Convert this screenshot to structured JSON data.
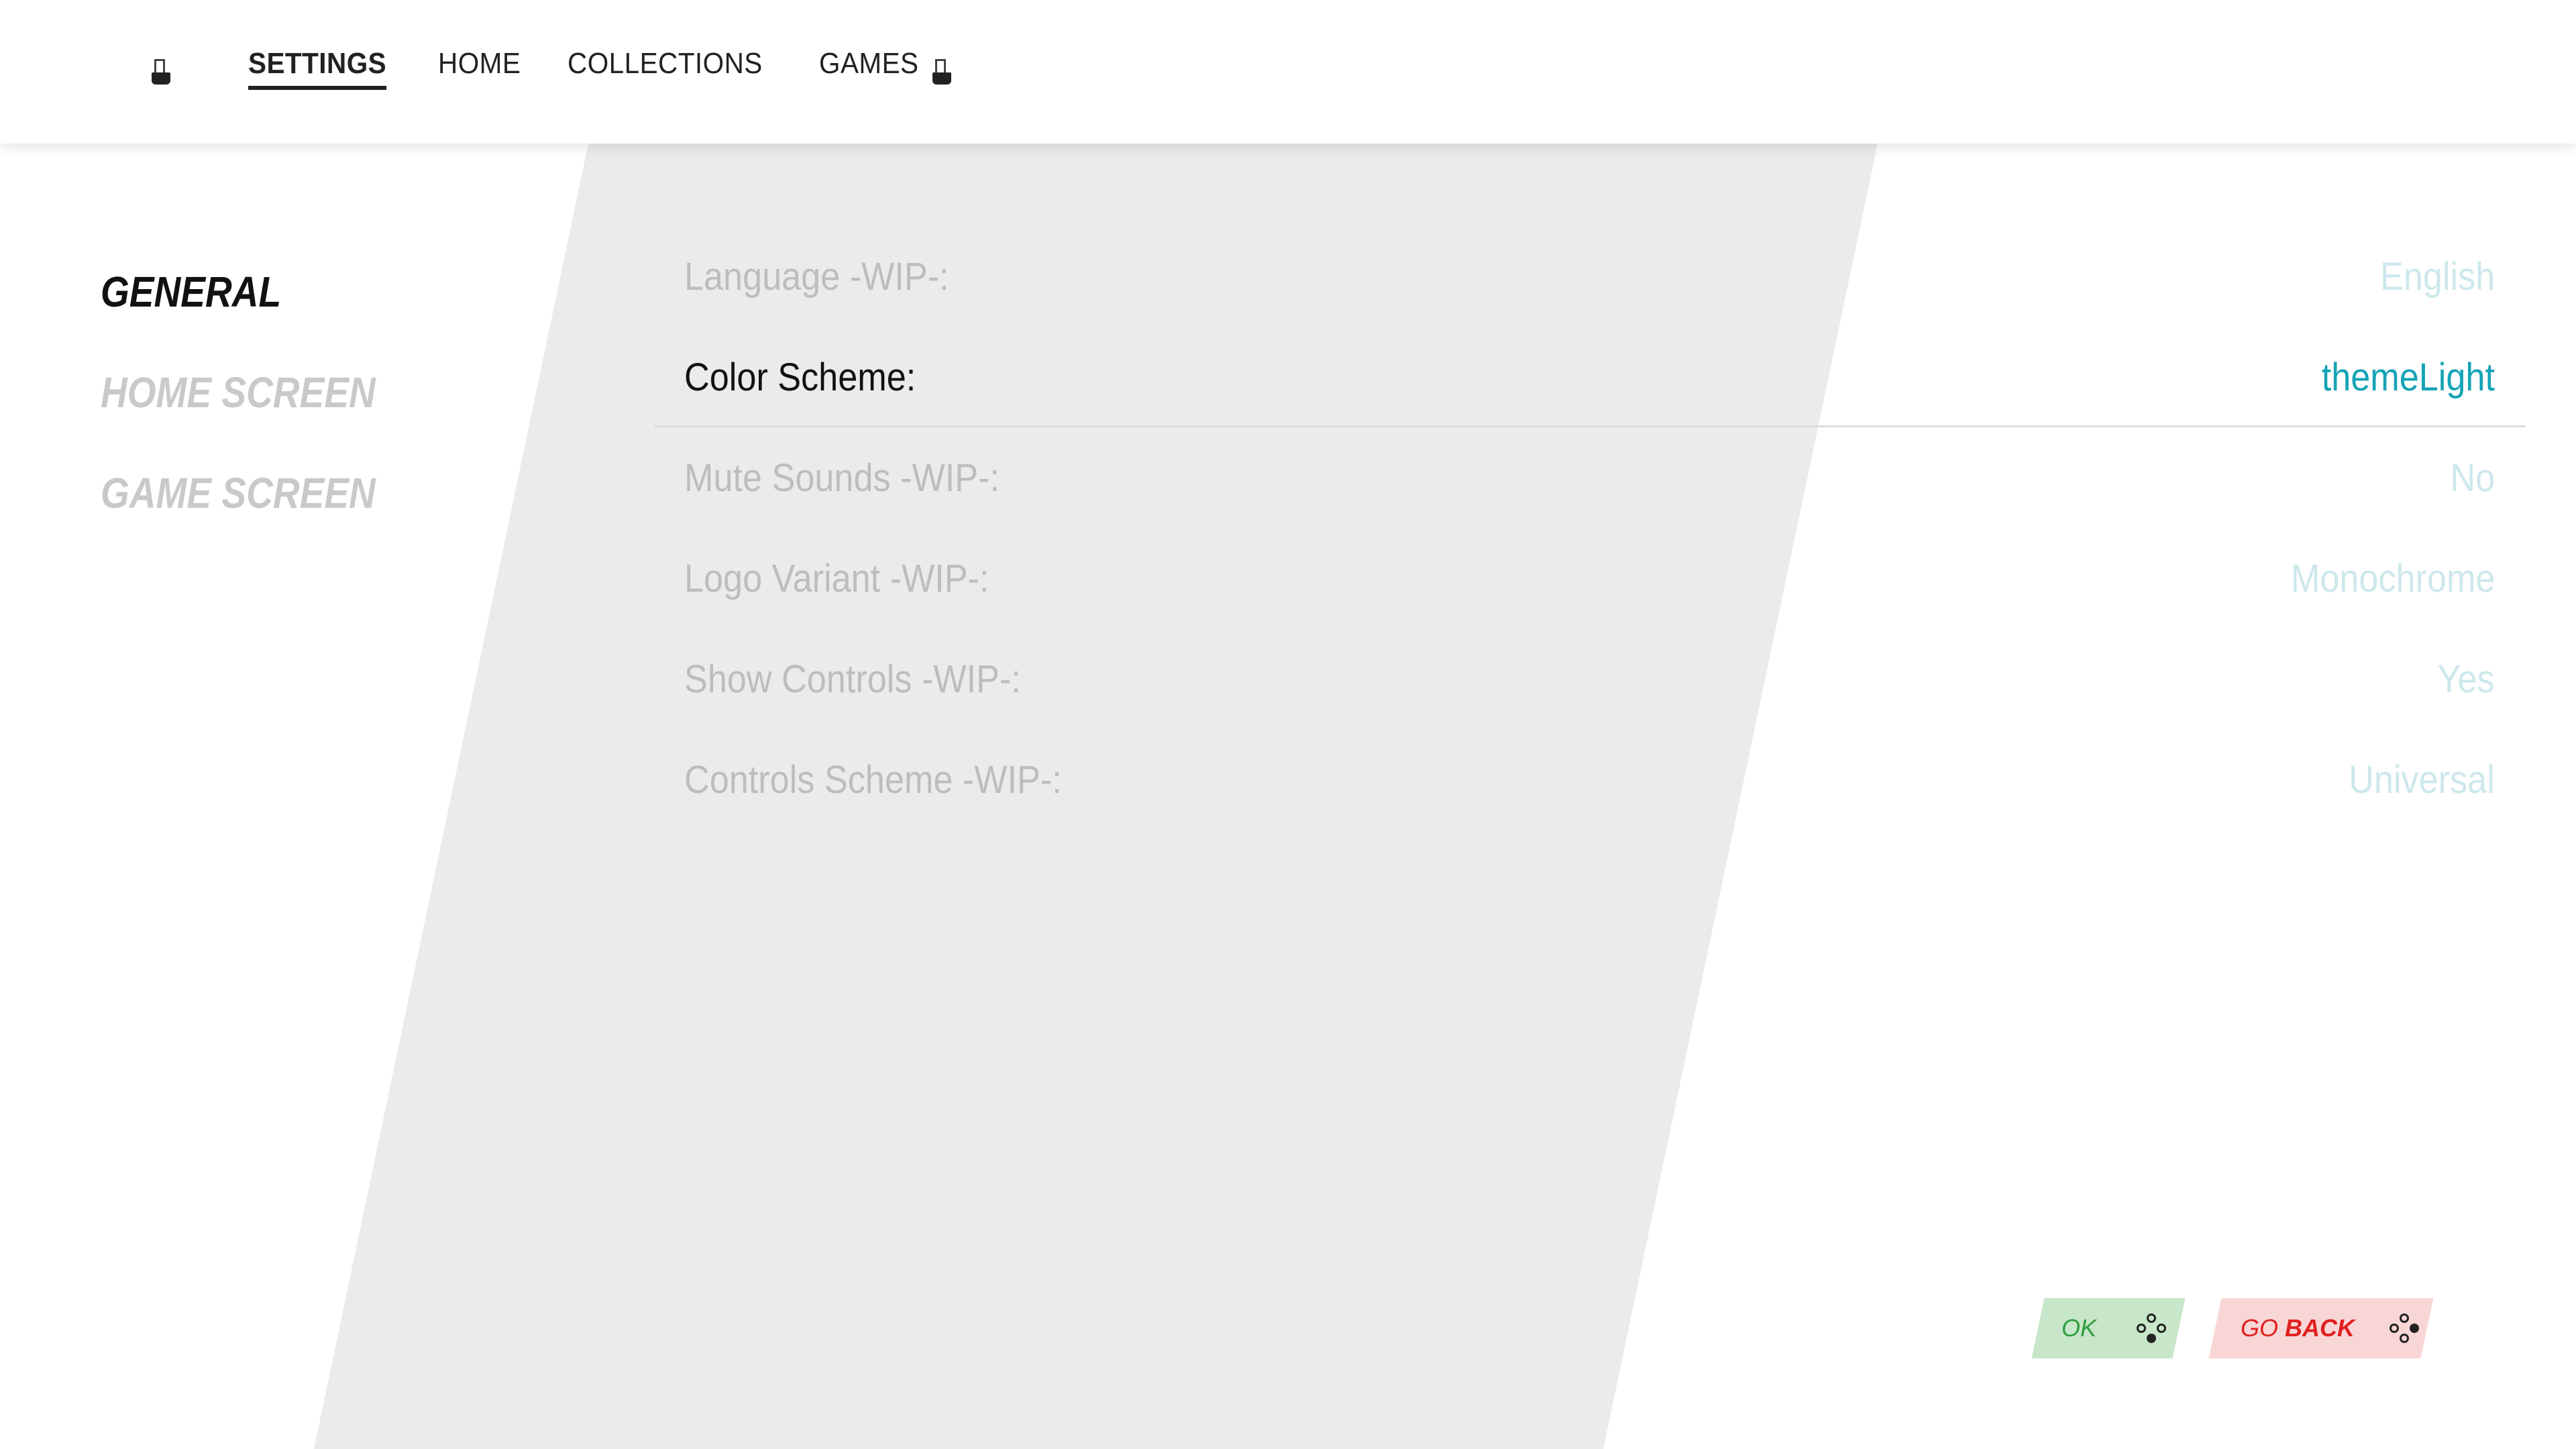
{
  "nav": {
    "left_icon": "controller-shoulder-left-icon",
    "right_icon": "controller-shoulder-right-icon",
    "items": [
      {
        "label": "SETTINGS",
        "active": true
      },
      {
        "label": "HOME",
        "active": false
      },
      {
        "label": "COLLECTIONS",
        "active": false
      },
      {
        "label": "GAMES",
        "active": false
      }
    ]
  },
  "sidebar": {
    "items": [
      {
        "label": "GENERAL",
        "active": true
      },
      {
        "label": "HOME SCREEN",
        "active": false
      },
      {
        "label": "GAME SCREEN",
        "active": false
      }
    ]
  },
  "settings": {
    "rows": [
      {
        "label": "Language -WIP-:",
        "value": "English",
        "selected": false
      },
      {
        "label": "Color Scheme:",
        "value": "themeLight",
        "selected": true
      },
      {
        "label": "Mute Sounds -WIP-:",
        "value": "No",
        "selected": false
      },
      {
        "label": "Logo Variant -WIP-:",
        "value": "Monochrome",
        "selected": false
      },
      {
        "label": "Show Controls -WIP-:",
        "value": "Yes",
        "selected": false
      },
      {
        "label": "Controls Scheme -WIP-:",
        "value": "Universal",
        "selected": false
      }
    ]
  },
  "buttons": {
    "ok": {
      "label": "OK",
      "icon": "dpad-down-icon"
    },
    "back": {
      "prefix": "GO",
      "label": "BACK",
      "icon": "dpad-right-icon"
    }
  },
  "colors": {
    "accent": "#13a3b5",
    "ok_bg": "#c8e6c9",
    "ok_text": "#2e9e3e",
    "back_bg": "#f9d6d6",
    "back_text": "#e02020",
    "panel": "#ebebeb"
  }
}
